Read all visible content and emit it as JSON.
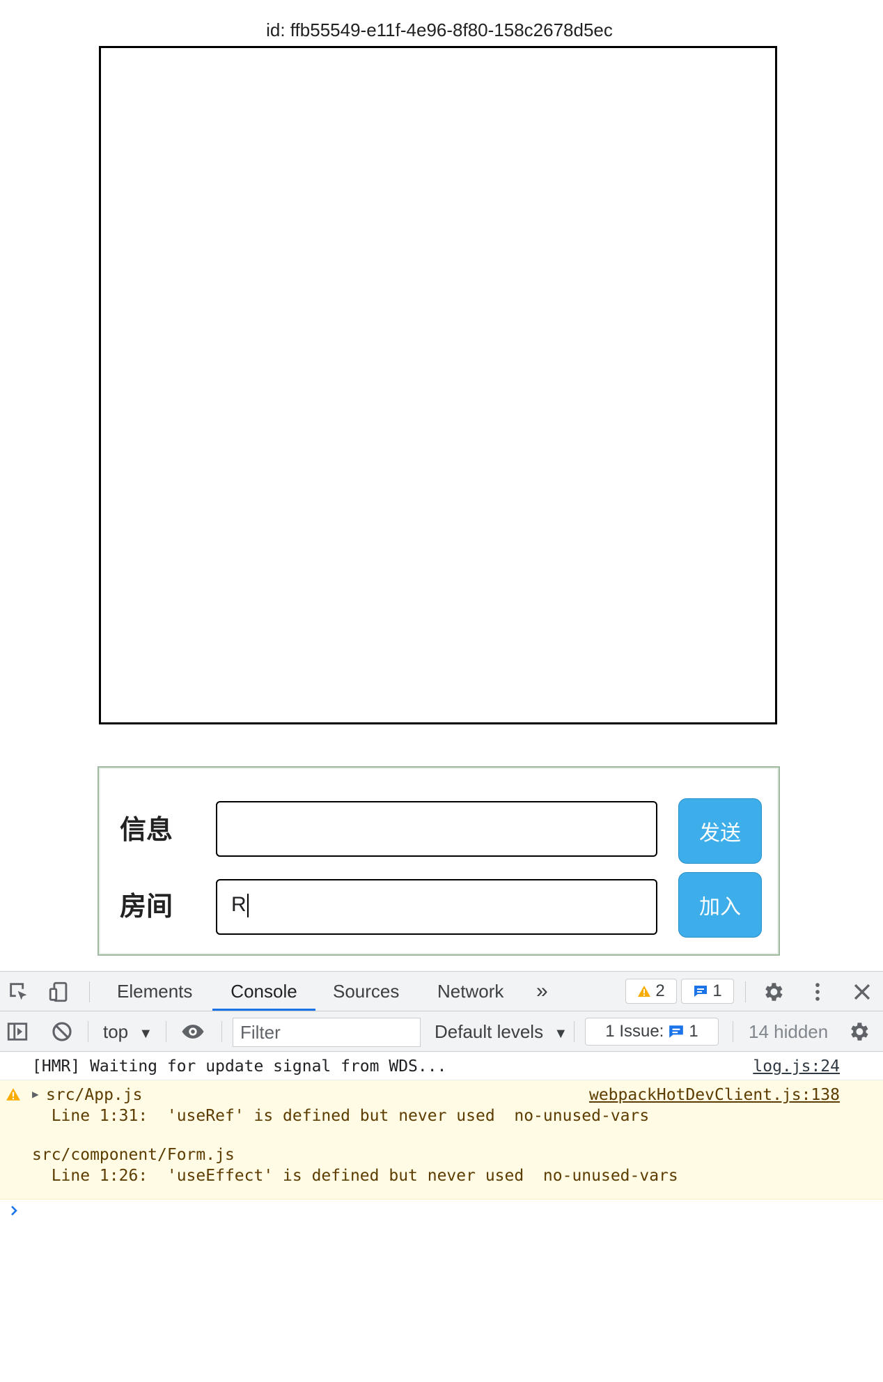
{
  "page": {
    "id_text": "id: ffb55549-e11f-4e96-8f80-158c2678d5ec",
    "form": {
      "message_label": "信息",
      "message_value": "",
      "send_button": "发送",
      "room_label": "房间",
      "room_value": "R",
      "join_button": "加入"
    }
  },
  "devtools": {
    "tabs": [
      "Elements",
      "Console",
      "Sources",
      "Network"
    ],
    "active_tab": "Console",
    "warnings_count": "2",
    "messages_count": "1",
    "context": "top",
    "filter_placeholder": "Filter",
    "levels": "Default levels",
    "issues_label": "1 Issue:",
    "issues_count": "1",
    "hidden_label": "14 hidden",
    "console": {
      "hmr_message": "[HMR] Waiting for update signal from WDS...",
      "hmr_source": "log.js:24",
      "warning": {
        "source": "webpackHotDevClient.js:138",
        "file1": "src/App.js",
        "line1": "  Line 1:31:  'useRef' is defined but never used  no-unused-vars",
        "file2": "src/component/Form.js",
        "line2": "  Line 1:26:  'useEffect' is defined but never used  no-unused-vars"
      }
    }
  },
  "colors": {
    "button_blue": "#3daee9",
    "devtools_bg": "#f1f3f4",
    "warning_bg": "#fffbe5",
    "accent": "#1a73e8"
  }
}
